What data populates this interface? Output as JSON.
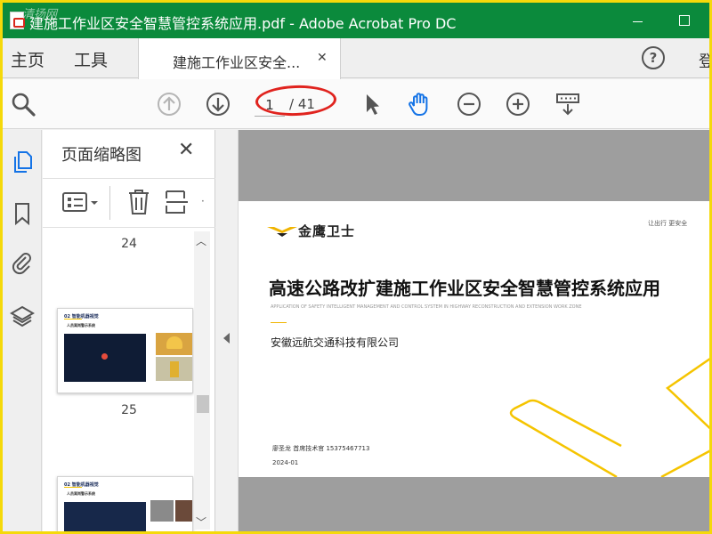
{
  "window": {
    "title": "建施工作业区安全智慧管控系统应用.pdf - Adobe Acrobat Pro DC",
    "watermark": "清扬网"
  },
  "tabs": {
    "home": "主页",
    "tools": "工具",
    "document": "建施工作业区安全...",
    "help_icon": "?",
    "login_partial": "登"
  },
  "toolbar": {
    "current_page": "1",
    "total_pages": "/ 41"
  },
  "thumbnail_panel": {
    "title": "页面缩略图",
    "page_numbers": [
      "24",
      "25"
    ],
    "thumb_header": "02 智能机器视觉",
    "thumb_subheader": "人员离岗警示系统"
  },
  "document_page": {
    "logo_text": "金鹰卫士",
    "slogan": "让出行 更安全",
    "main_title": "高速公路改扩建施工作业区安全智慧管控系统应用",
    "english_title": "APPLICATION OF SAFETY INTELLIGENT MANAGEMENT AND CONTROL SYSTEM IN HIGHWAY RECONSTRUCTION AND  EXTENSION WORK ZONE",
    "company": "安徽远航交通科技有限公司",
    "author_line": "廖圣龙    首席技术官    15375467713",
    "date": "2024-01"
  },
  "colors": {
    "titlebar": "#0b8a3c",
    "accent_yellow": "#f5c400",
    "annotation_red": "#e0231e",
    "frame_yellow": "#f5d90a"
  }
}
